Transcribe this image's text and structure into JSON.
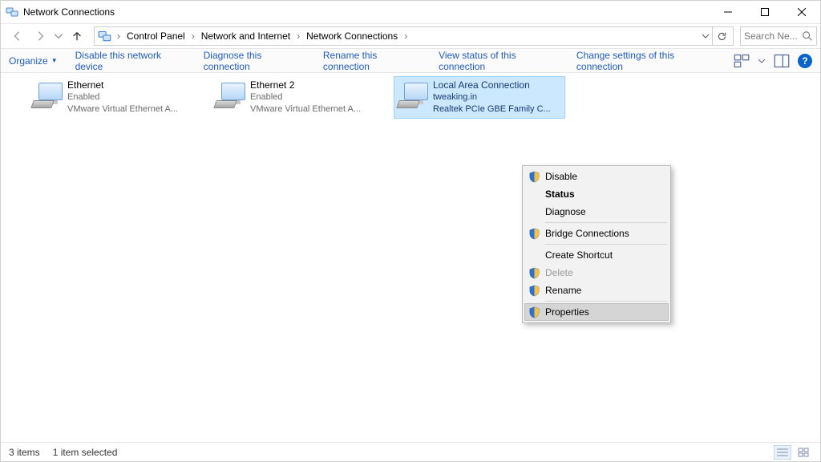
{
  "window": {
    "title": "Network Connections"
  },
  "breadcrumbs": {
    "items": [
      "Control Panel",
      "Network and Internet",
      "Network Connections"
    ]
  },
  "search": {
    "placeholder": "Search Ne..."
  },
  "commands": {
    "organize": "Organize",
    "disable": "Disable this network device",
    "diagnose": "Diagnose this connection",
    "rename": "Rename this connection",
    "viewstatus": "View status of this connection",
    "changesettings": "Change settings of this connection"
  },
  "adapters": [
    {
      "name": "Ethernet",
      "line2": "Enabled",
      "line3": "VMware Virtual Ethernet A...",
      "selected": false
    },
    {
      "name": "Ethernet 2",
      "line2": "Enabled",
      "line3": "VMware Virtual Ethernet A...",
      "selected": false
    },
    {
      "name": "Local Area Connection",
      "line2": "tweaking.in",
      "line3": "Realtek PCIe GBE Family C...",
      "selected": true
    }
  ],
  "context_menu": {
    "items": [
      {
        "label": "Disable",
        "shield": true,
        "bold": false,
        "disabled": false
      },
      {
        "label": "Status",
        "shield": false,
        "bold": true,
        "disabled": false
      },
      {
        "label": "Diagnose",
        "shield": false,
        "bold": false,
        "disabled": false
      },
      {
        "sep": true
      },
      {
        "label": "Bridge Connections",
        "shield": true,
        "bold": false,
        "disabled": false
      },
      {
        "sep": true
      },
      {
        "label": "Create Shortcut",
        "shield": false,
        "bold": false,
        "disabled": false
      },
      {
        "label": "Delete",
        "shield": true,
        "bold": false,
        "disabled": true
      },
      {
        "label": "Rename",
        "shield": true,
        "bold": false,
        "disabled": false
      },
      {
        "sep": true
      },
      {
        "label": "Properties",
        "shield": true,
        "bold": false,
        "disabled": false,
        "hover": true
      }
    ]
  },
  "statusbar": {
    "count": "3 items",
    "selected": "1 item selected"
  }
}
